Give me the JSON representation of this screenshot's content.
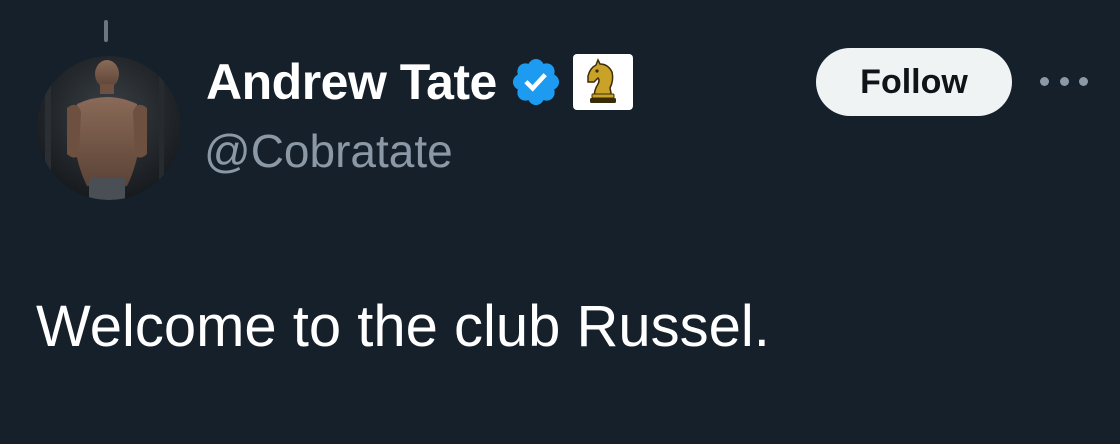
{
  "tweet": {
    "author": {
      "display_name": "Andrew Tate",
      "handle": "@Cobratate",
      "verified": true,
      "avatar_icon": "profile-photo",
      "affiliate_badge_icon": "chess-knight-icon"
    },
    "follow_label": "Follow",
    "more_icon": "more-options-icon",
    "text": "Welcome to the club Russel."
  },
  "colors": {
    "background": "#15202b",
    "verified_blue": "#1d9bf0",
    "handle_gray": "#8b98a5",
    "follow_bg": "#eff3f4",
    "knight_gold": "#c9a227"
  }
}
